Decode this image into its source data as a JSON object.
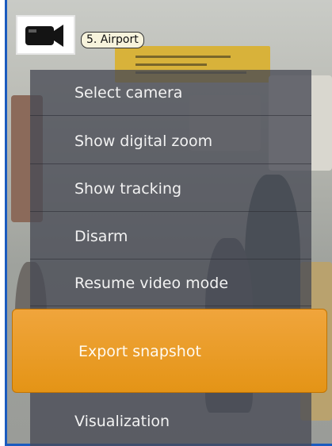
{
  "camera": {
    "label": "5. Airport",
    "icon": "video-camera-icon"
  },
  "context_menu": {
    "items": [
      {
        "label": "Select camera"
      },
      {
        "label": "Show digital zoom"
      },
      {
        "label": "Show tracking"
      },
      {
        "label": "Disarm"
      },
      {
        "label": "Resume video mode"
      },
      {
        "label": "Export snapshot",
        "highlighted": true
      },
      {
        "label": "Visualization"
      }
    ]
  },
  "colors": {
    "highlight": "#e89a22",
    "menu_bg": "#484a54",
    "frame_border": "#1b5bbf"
  }
}
